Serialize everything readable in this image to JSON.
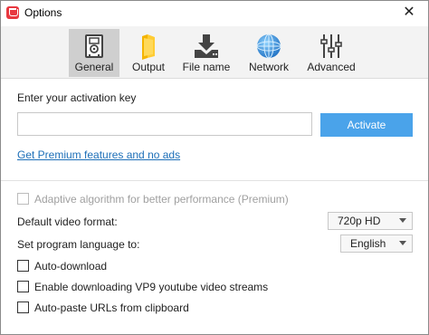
{
  "window": {
    "title": "Options",
    "close_glyph": "✕"
  },
  "tabs": [
    {
      "label": "General",
      "icon": "general-settings-icon",
      "active": true
    },
    {
      "label": "Output",
      "icon": "folder-icon",
      "active": false
    },
    {
      "label": "File name",
      "icon": "download-icon",
      "active": false
    },
    {
      "label": "Network",
      "icon": "globe-icon",
      "active": false
    },
    {
      "label": "Advanced",
      "icon": "sliders-icon",
      "active": false
    }
  ],
  "activation": {
    "label": "Enter your activation key",
    "input_value": "",
    "input_placeholder": "",
    "button_label": "Activate"
  },
  "premium_link": "Get Premium features and no ads",
  "options": {
    "adaptive": {
      "label": "Adaptive algorithm for better performance (Premium)",
      "checked": false,
      "disabled": true
    },
    "video_format": {
      "label": "Default video format:",
      "value": "720p HD"
    },
    "language": {
      "label": "Set program language to:",
      "value": "English"
    },
    "auto_download": {
      "label": "Auto-download",
      "checked": false
    },
    "vp9": {
      "label": "Enable downloading VP9 youtube video streams",
      "checked": false
    },
    "auto_paste": {
      "label": "Auto-paste URLs from clipboard",
      "checked": false
    }
  },
  "colors": {
    "accent": "#4aa3ea",
    "link": "#1d6fb8",
    "brand": "#e8373f",
    "active_tab": "#cfcfcf"
  }
}
